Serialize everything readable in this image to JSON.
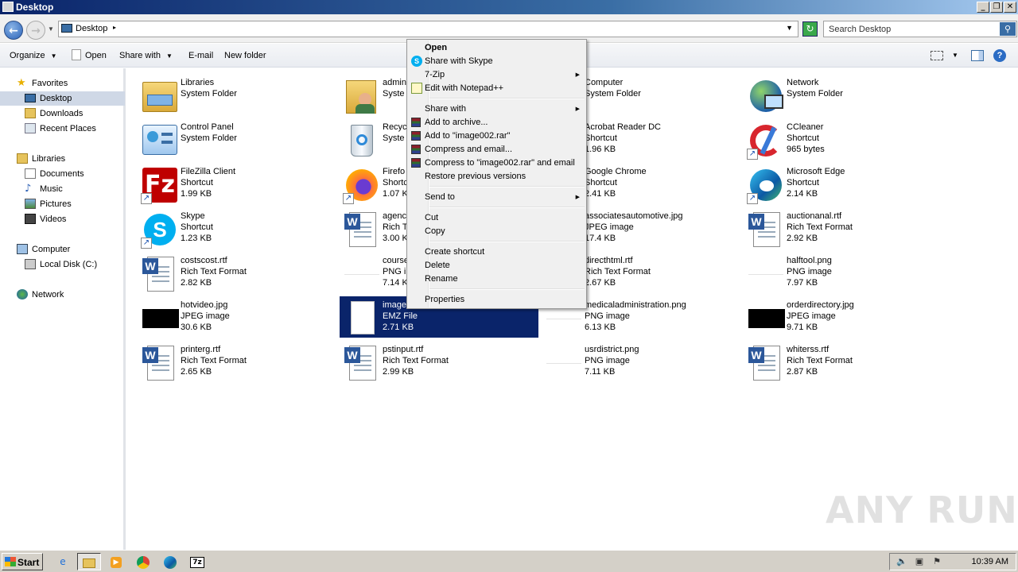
{
  "window": {
    "title": "Desktop"
  },
  "address": {
    "location": "Desktop",
    "search_placeholder": "Search Desktop"
  },
  "toolbar": {
    "organize": "Organize",
    "open": "Open",
    "share_with": "Share with",
    "email": "E-mail",
    "new_folder": "New folder"
  },
  "nav": {
    "favorites": "Favorites",
    "desktop": "Desktop",
    "downloads": "Downloads",
    "recent_places": "Recent Places",
    "libraries": "Libraries",
    "documents": "Documents",
    "music": "Music",
    "pictures": "Pictures",
    "videos": "Videos",
    "computer": "Computer",
    "local_disk": "Local Disk (C:)",
    "network": "Network"
  },
  "files": [
    {
      "name": "Libraries",
      "type": "System Folder",
      "size": "",
      "icon": "libraries-icon"
    },
    {
      "name": "admin",
      "type": "Syste",
      "size": "",
      "icon": "user-folder-icon"
    },
    {
      "name": "Computer",
      "type": "System Folder",
      "size": "",
      "icon": "computer-icon"
    },
    {
      "name": "Network",
      "type": "System Folder",
      "size": "",
      "icon": "network-icon"
    },
    {
      "name": "Control Panel",
      "type": "System Folder",
      "size": "",
      "icon": "control-panel-icon"
    },
    {
      "name": "Recyc",
      "type": "Syste",
      "size": "",
      "icon": "recycle-bin-icon"
    },
    {
      "name": "Acrobat Reader DC",
      "type": "Shortcut",
      "size": "1.96 KB",
      "icon": "acrobat-icon"
    },
    {
      "name": "CCleaner",
      "type": "Shortcut",
      "size": "965 bytes",
      "icon": "ccleaner-icon"
    },
    {
      "name": "FileZilla Client",
      "type": "Shortcut",
      "size": "1.99 KB",
      "icon": "filezilla-icon"
    },
    {
      "name": "Firefo",
      "type": "Shortc",
      "size": "1.07 K",
      "icon": "firefox-icon"
    },
    {
      "name": "Google Chrome",
      "type": "Shortcut",
      "size": "2.41 KB",
      "icon": "chrome-icon"
    },
    {
      "name": "Microsoft Edge",
      "type": "Shortcut",
      "size": "2.14 KB",
      "icon": "edge-icon"
    },
    {
      "name": "Skype",
      "type": "Shortcut",
      "size": "1.23 KB",
      "icon": "skype-icon"
    },
    {
      "name": "agenc",
      "type": "Rich T",
      "size": "3.00 K",
      "icon": "rtf-icon"
    },
    {
      "name": "associatesautomotive.jpg",
      "type": "JPEG image",
      "size": "17.4 KB",
      "icon": "blank-image-icon"
    },
    {
      "name": "auctionanal.rtf",
      "type": "Rich Text Format",
      "size": "2.92 KB",
      "icon": "rtf-icon"
    },
    {
      "name": "costscost.rtf",
      "type": "Rich Text Format",
      "size": "2.82 KB",
      "icon": "rtf-icon"
    },
    {
      "name": "course",
      "type": "PNG in",
      "size": "7.14 K",
      "icon": "blank-image-icon"
    },
    {
      "name": "directhtml.rtf",
      "type": "Rich Text Format",
      "size": "2.67 KB",
      "icon": "rtf-icon"
    },
    {
      "name": "halftool.png",
      "type": "PNG image",
      "size": "7.97 KB",
      "icon": "blank-image-icon"
    },
    {
      "name": "hotvideo.jpg",
      "type": "JPEG image",
      "size": "30.6 KB",
      "icon": "black-image-icon"
    },
    {
      "name": "image",
      "type": "EMZ File",
      "size": "2.71 KB",
      "icon": "emz-file-icon"
    },
    {
      "name": "medicaladministration.png",
      "type": "PNG image",
      "size": "6.13 KB",
      "icon": "blank-image-icon"
    },
    {
      "name": "orderdirectory.jpg",
      "type": "JPEG image",
      "size": "9.71 KB",
      "icon": "black-image-icon"
    },
    {
      "name": "printerg.rtf",
      "type": "Rich Text Format",
      "size": "2.65 KB",
      "icon": "rtf-icon"
    },
    {
      "name": "pstinput.rtf",
      "type": "Rich Text Format",
      "size": "2.99 KB",
      "icon": "rtf-icon"
    },
    {
      "name": "usrdistrict.png",
      "type": "PNG image",
      "size": "7.11 KB",
      "icon": "blank-image-icon"
    },
    {
      "name": "whiterss.rtf",
      "type": "Rich Text Format",
      "size": "2.87 KB",
      "icon": "rtf-icon"
    }
  ],
  "context_menu": {
    "open": "Open",
    "share_skype": "Share with Skype",
    "seven_zip": "7-Zip",
    "notepad": "Edit with Notepad++",
    "share_with": "Share with",
    "add_archive": "Add to archive...",
    "add_rar": "Add to \"image002.rar\"",
    "compress_email": "Compress and email...",
    "compress_rar_email": "Compress to \"image002.rar\" and email",
    "restore": "Restore previous versions",
    "send_to": "Send to",
    "cut": "Cut",
    "copy": "Copy",
    "create_shortcut": "Create shortcut",
    "delete": "Delete",
    "rename": "Rename",
    "properties": "Properties"
  },
  "taskbar": {
    "start": "Start",
    "clock": "10:39 AM"
  },
  "watermark": "ANY RUN"
}
